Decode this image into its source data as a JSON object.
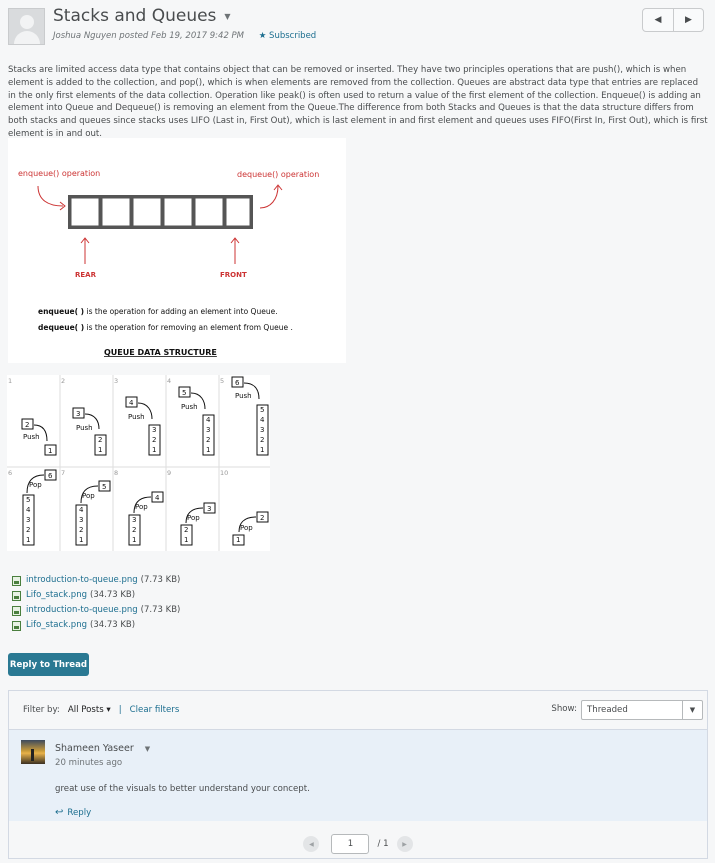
{
  "thread": {
    "title": "Stacks and Queues",
    "author_line": "Joshua Nguyen posted Feb 19, 2017 9:42 PM",
    "subscribed": "Subscribed",
    "prev_symbol": "◀",
    "next_symbol": "▶"
  },
  "post": {
    "body": "Stacks are limited access data type that contains object that can be removed or inserted. They have two principles operations that are push(), which is when element is added to the collection, and pop(), which is when elements are removed from the collection. Queues are abstract data type that entries are replaced in the only first elements of the data collection. Operation like peak() is often used to return a value of the first element of the collection. Enqueue() is adding an element into Queue and Dequeue() is removing an element from the Queue.The difference from both Stacks and Queues is that the data structure differs from both stacks and queues since stacks uses LIFO (Last in, First Out), which is last element in and first element  and queues uses FIFO(First In, First Out), which is first element is in and out."
  },
  "queue_image": {
    "enqueue_label": "enqueue() operation",
    "dequeue_label": "dequeue() operation",
    "rear": "REAR",
    "front": "FRONT",
    "enqueue_desc_bold": "enqueue( )",
    "enqueue_desc": " is the operation for adding an element into Queue.",
    "dequeue_desc_bold": "dequeue( )",
    "dequeue_desc": " is the operation for removing an element from Queue .",
    "caption": "QUEUE DATA STRUCTURE"
  },
  "stack_image": {
    "frames": [
      "1",
      "2",
      "3",
      "4",
      "5",
      "6",
      "7",
      "8",
      "9",
      "10"
    ],
    "push": "Push",
    "pop": "Pop",
    "numbers": [
      "1",
      "2",
      "3",
      "4",
      "5",
      "6"
    ]
  },
  "attachments": [
    {
      "name": "introduction-to-queue.png",
      "size": "(7.73 KB)"
    },
    {
      "name": "Lifo_stack.png",
      "size": "(34.73 KB)"
    },
    {
      "name": "introduction-to-queue.png",
      "size": "(7.73 KB)"
    },
    {
      "name": "Lifo_stack.png",
      "size": "(34.73 KB)"
    }
  ],
  "reply_thread_label": "Reply to Thread",
  "filter": {
    "label": "Filter by:",
    "value": "All Posts",
    "separator": "|",
    "clear": "Clear filters",
    "show_label": "Show:",
    "show_value": "Threaded"
  },
  "reply": {
    "name": "Shameen Yaseer",
    "time": "20 minutes ago",
    "body": "great use of the visuals to better understand your concept.",
    "reply_label": "Reply"
  },
  "pager": {
    "page": "1",
    "total": "/ 1"
  },
  "colors": {
    "accent": "#1c6e8f",
    "button": "#2a7993",
    "reply_bg": "#e8f0f8",
    "diagram_red": "#c33"
  }
}
